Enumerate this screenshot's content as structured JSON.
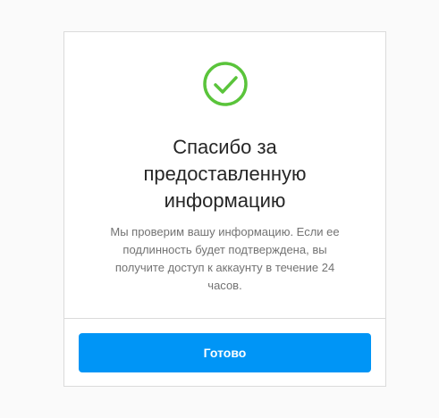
{
  "confirmation": {
    "icon": "check-circle-icon",
    "accent_color": "#5ac43b",
    "title": "Спасибо за предоставленную информацию",
    "description": "Мы проверим вашу информацию. Если ее подлинность будет подтверждена, вы получите доступ к аккаунту в течение 24 часов.",
    "done_label": "Готово",
    "button_color": "#0095f6"
  }
}
